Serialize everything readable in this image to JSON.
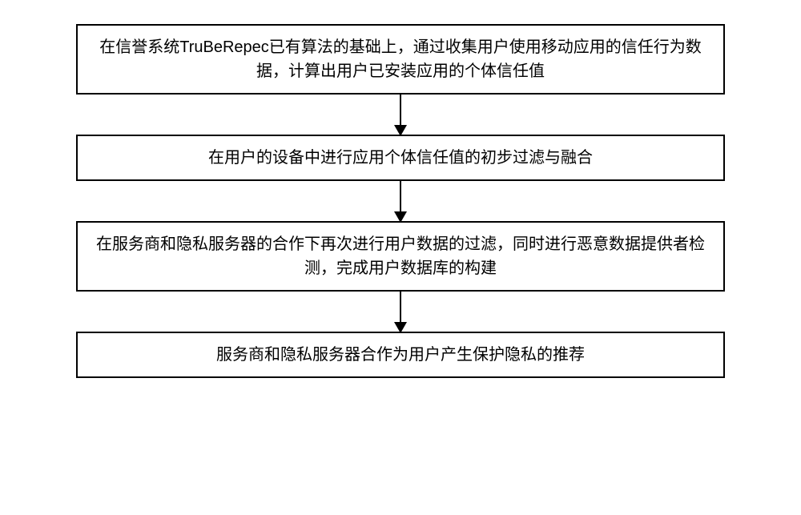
{
  "steps": [
    {
      "id": "S101",
      "text": "在信誉系统TruBeRepec已有算法的基础上，通过收集用户使用移动应用的信任行为数据，计算出用户已安装应用的个体信任值"
    },
    {
      "id": "S102",
      "text": "在用户的设备中进行应用个体信任值的初步过滤与融合"
    },
    {
      "id": "S103",
      "text": "在服务商和隐私服务器的合作下再次进行用户数据的过滤，同时进行恶意数据提供者检测，完成用户数据库的构建"
    },
    {
      "id": "S104",
      "text": "服务商和隐私服务器合作为用户产生保护隐私的推荐"
    }
  ]
}
